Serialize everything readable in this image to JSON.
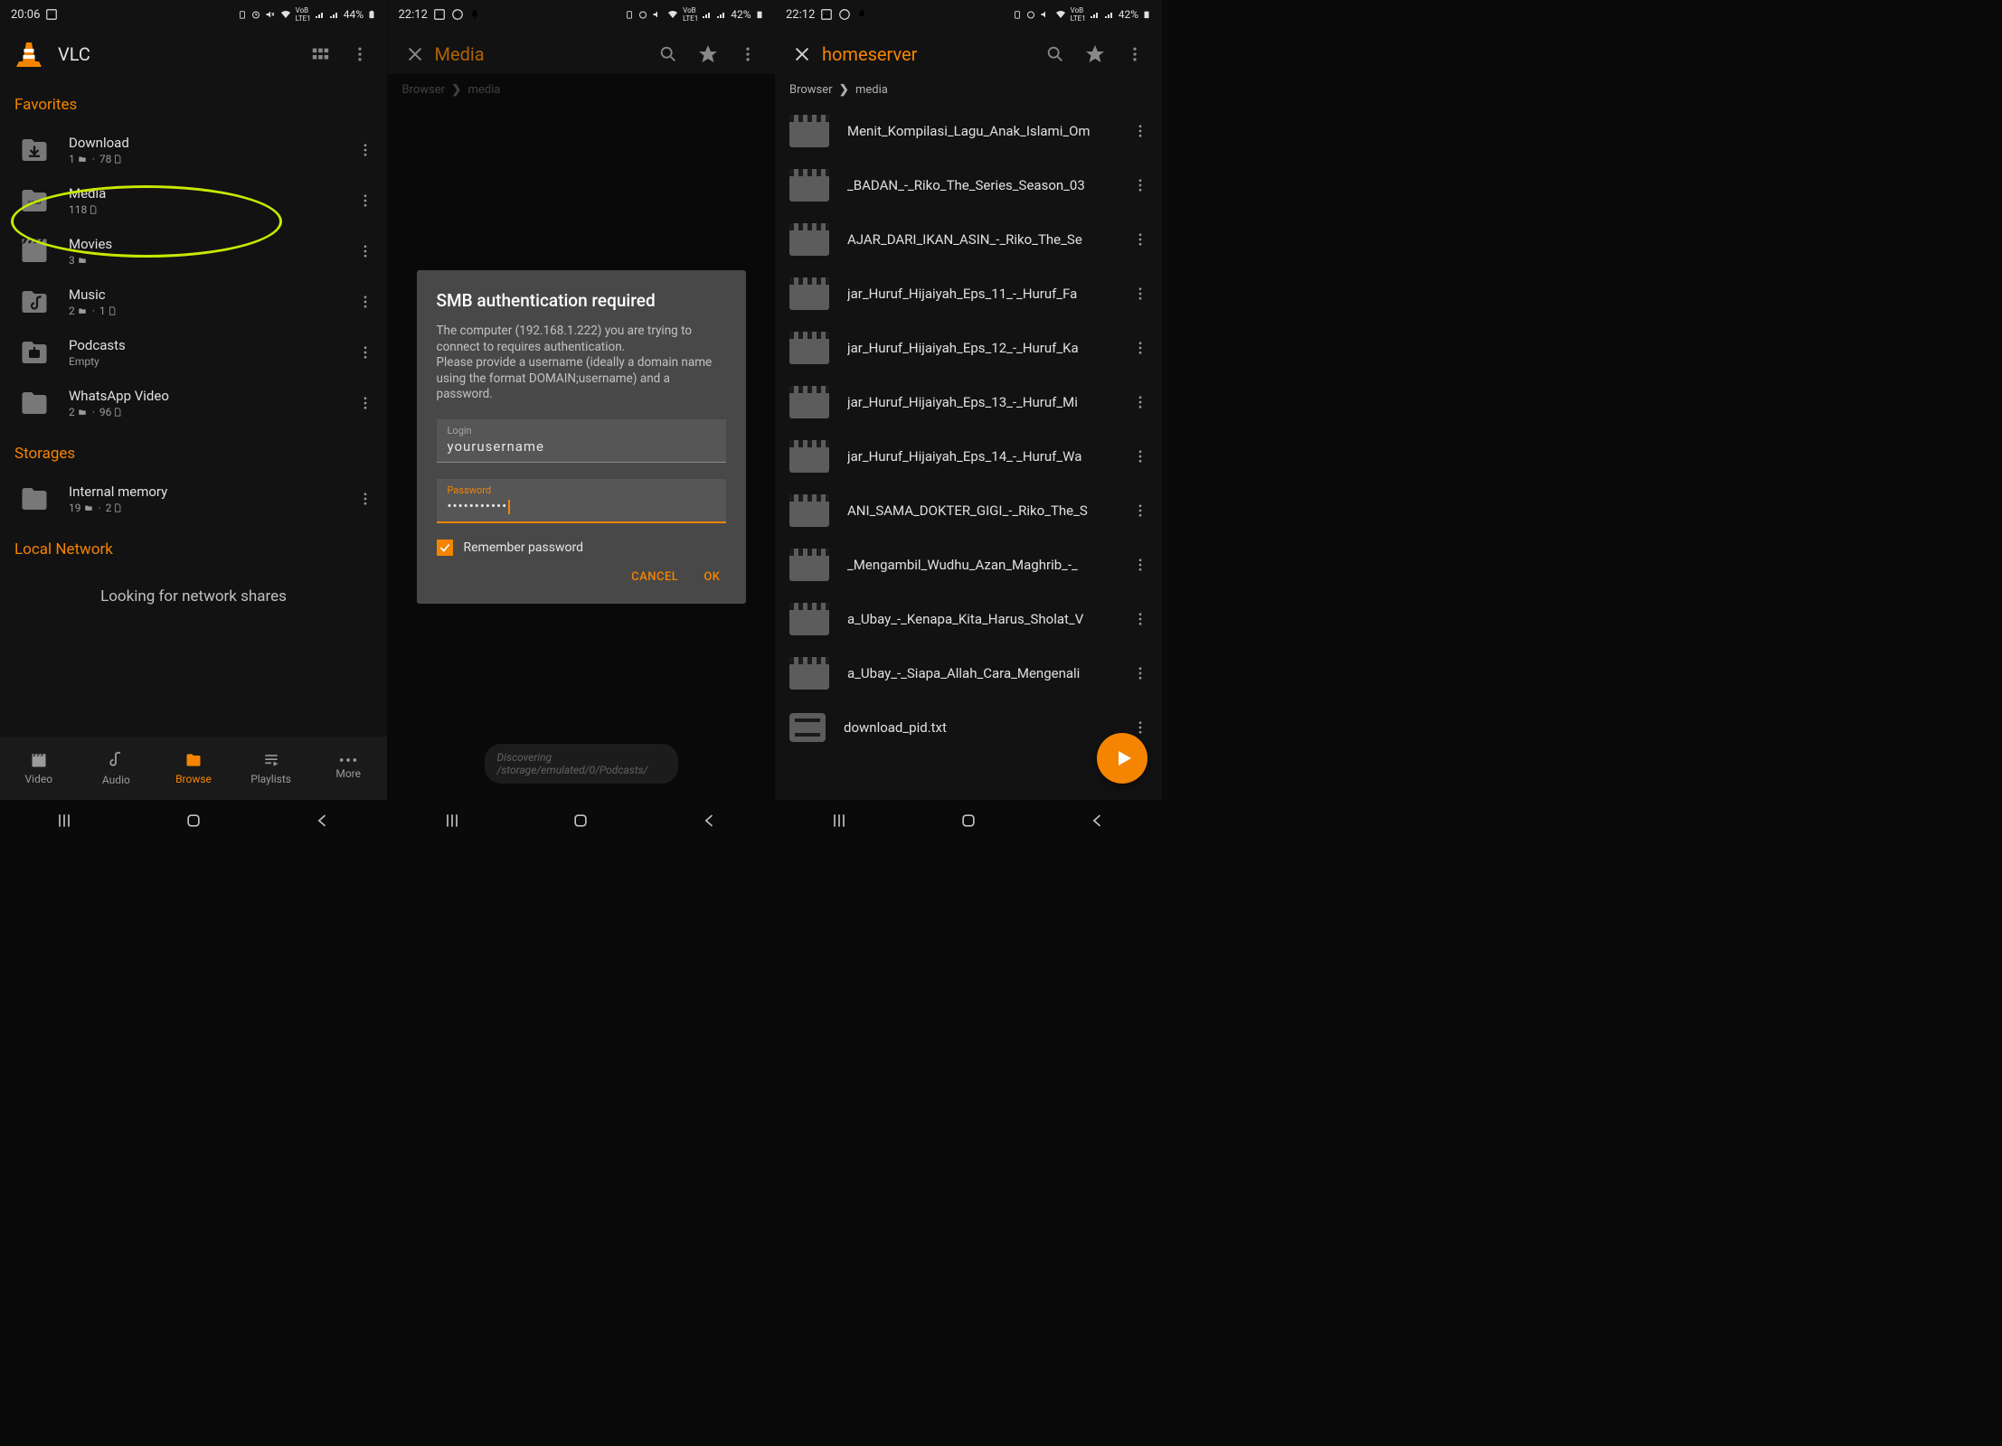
{
  "screen1": {
    "status_time": "20:06",
    "battery": "44%",
    "app_title": "VLC",
    "sections": {
      "favorites": "Favorites",
      "storages": "Storages",
      "local_network": "Local Network"
    },
    "favorites": [
      {
        "title": "Download",
        "sub_folders": "1",
        "sub_files": "78",
        "icon": "download"
      },
      {
        "title": "Media",
        "sub_folders": null,
        "sub_files": "118",
        "icon": "smb"
      },
      {
        "title": "Movies",
        "sub_folders": "3",
        "sub_files": null,
        "icon": "video"
      },
      {
        "title": "Music",
        "sub_folders": "2",
        "sub_files": "1",
        "icon": "music"
      },
      {
        "title": "Podcasts",
        "sub_text": "Empty",
        "icon": "podcast"
      },
      {
        "title": "WhatsApp Video",
        "sub_folders": "2",
        "sub_files": "96",
        "icon": "folder"
      }
    ],
    "storages": [
      {
        "title": "Internal memory",
        "sub_folders": "19",
        "sub_files": "2",
        "icon": "folder"
      }
    ],
    "looking": "Looking for network shares",
    "bottom_nav": {
      "video": "Video",
      "audio": "Audio",
      "browse": "Browse",
      "playlists": "Playlists",
      "more": "More"
    }
  },
  "screen2": {
    "status_time": "22:12",
    "battery": "42%",
    "toolbar_title": "Media",
    "breadcrumb_root": "Browser",
    "breadcrumb_leaf": "media",
    "dialog": {
      "title": "SMB authentication required",
      "body": "The computer (192.168.1.222) you are trying to connect to requires authentication.\nPlease provide a username (ideally a domain name using the format DOMAIN;username) and a password.",
      "login_label": "Login",
      "login_value": "yourusername",
      "password_label": "Password",
      "password_value": "•••••••••••",
      "remember": "Remember password",
      "cancel": "CANCEL",
      "ok": "OK"
    },
    "toast": "Discovering /storage/emulated/0/Podcasts/"
  },
  "screen3": {
    "status_time": "22:12",
    "battery": "42%",
    "toolbar_title": "homeserver",
    "breadcrumb_root": "Browser",
    "breadcrumb_leaf": "media",
    "items": [
      {
        "title": "Menit_Kompilasi_Lagu_Anak_Islami_Om"
      },
      {
        "title": "_BADAN_-_Riko_The_Series_Season_03"
      },
      {
        "title": "AJAR_DARI_IKAN_ASIN_-_Riko_The_Se"
      },
      {
        "title": "jar_Huruf_Hijaiyah_Eps_11_-_Huruf_Fa"
      },
      {
        "title": "jar_Huruf_Hijaiyah_Eps_12_-_Huruf_Ka"
      },
      {
        "title": "jar_Huruf_Hijaiyah_Eps_13_-_Huruf_Mi"
      },
      {
        "title": "jar_Huruf_Hijaiyah_Eps_14_-_Huruf_Wa"
      },
      {
        "title": "ANI_SAMA_DOKTER_GIGI_-_Riko_The_S"
      },
      {
        "title": "_Mengambil_Wudhu_Azan_Maghrib_-_"
      },
      {
        "title": "a_Ubay_-_Kenapa_Kita_Harus_Sholat_V"
      },
      {
        "title": "a_Ubay_-_Siapa_Allah_Cara_Mengenali"
      }
    ],
    "file_item": "download_pid.txt"
  }
}
